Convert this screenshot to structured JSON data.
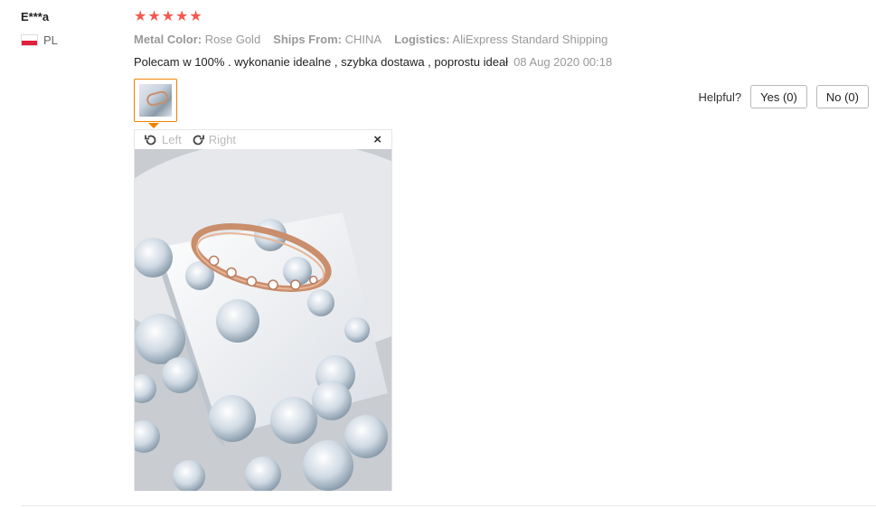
{
  "review": {
    "user": {
      "name": "E***a",
      "country": "PL"
    },
    "rating_stars": 5,
    "attributes": [
      {
        "key": "Metal Color:",
        "value": "Rose Gold"
      },
      {
        "key": "Ships From:",
        "value": "CHINA"
      },
      {
        "key": "Logistics:",
        "value": "AliExpress Standard Shipping"
      }
    ],
    "text": "Polecam w 100% . wykonanie idealne , szybka dostawa , poprostu ideał",
    "date": "08 Aug 2020 00:18",
    "helpful": {
      "label": "Helpful?",
      "yes_label": "Yes (0)",
      "no_label": "No (0)"
    },
    "viewer": {
      "rotate_left_label": "Left",
      "rotate_right_label": "Right",
      "close_glyph": "×"
    },
    "colors": {
      "star": "#f4594f",
      "thumb_border": "#f08200",
      "flag_red": "#e3203c"
    }
  }
}
